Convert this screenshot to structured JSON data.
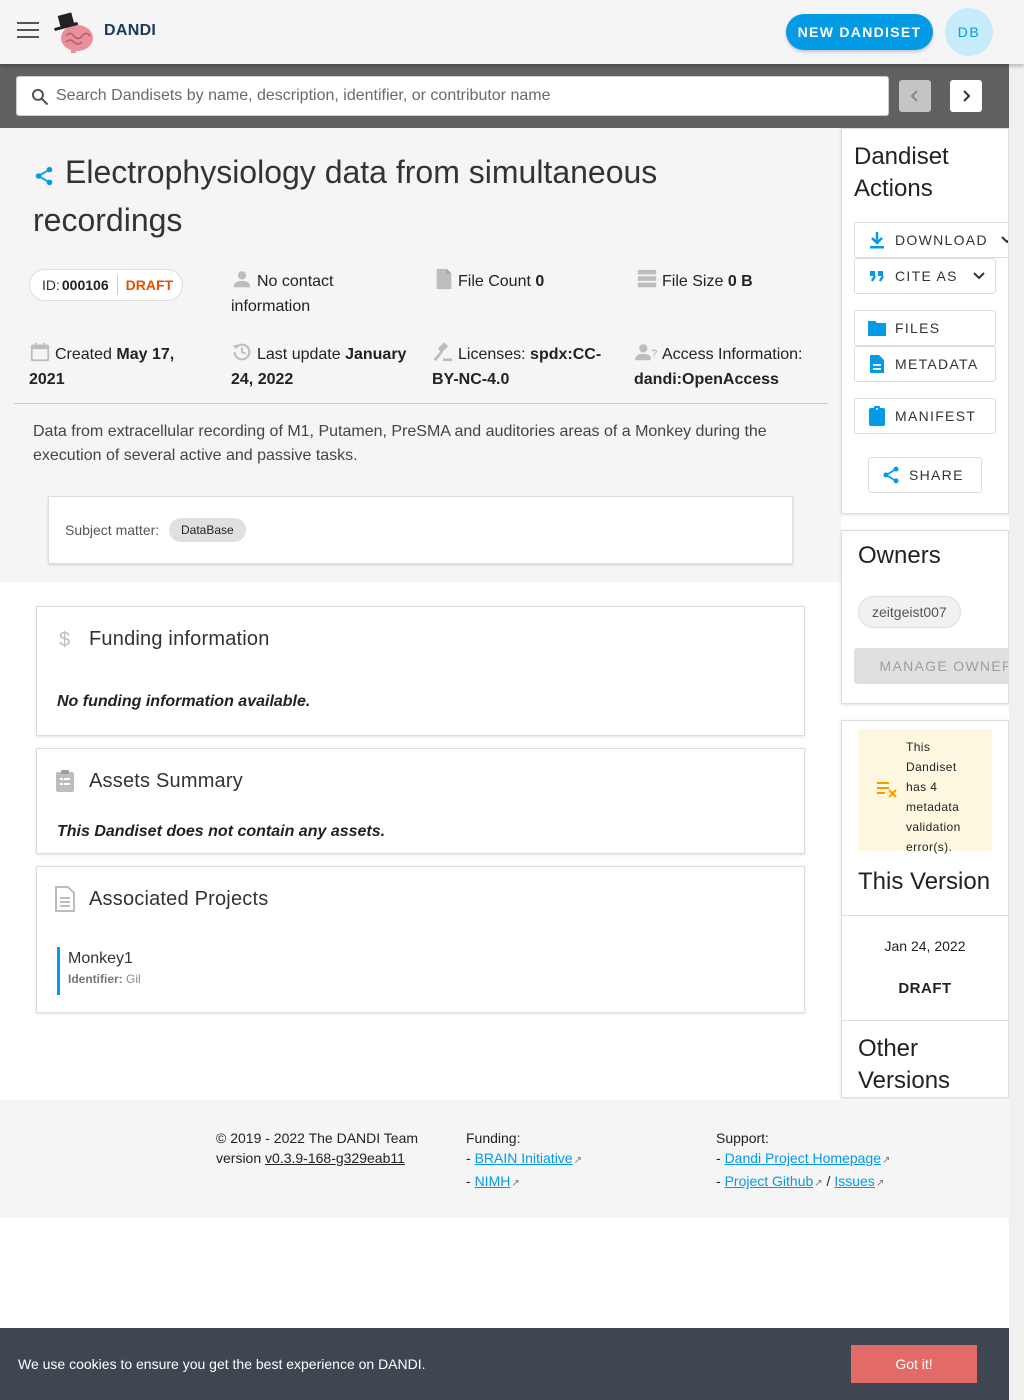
{
  "appbar": {
    "brand": "DANDI",
    "new_dandiset_label": "NEW DANDISET",
    "avatar_initials": "DB"
  },
  "search": {
    "placeholder": "Search Dandisets by name, description, identifier, or contributor name"
  },
  "dandiset": {
    "title": "Electrophysiology data from simultaneous recordings",
    "id_label": "ID:",
    "id": "000106",
    "status": "DRAFT",
    "contact": "No contact information",
    "file_count_label": "File Count",
    "file_count": "0",
    "file_size_label": "File Size",
    "file_size": "0 B",
    "created_label": "Created",
    "created": "May 17, 2021",
    "updated_label": "Last update",
    "updated": "January 24, 2022",
    "licenses_label": "Licenses:",
    "license": "spdx:CC-BY-NC-4.0",
    "access_label": "Access Information:",
    "access": "dandi:OpenAccess",
    "description": "Data from extracellular recording of M1, Putamen, PreSMA and auditories areas of a Monkey during the execution of several active and passive tasks.",
    "subject_label": "Subject matter:",
    "subject_tag": "DataBase"
  },
  "funding": {
    "title": "Funding information",
    "empty": "No funding information available."
  },
  "assets": {
    "title": "Assets Summary",
    "empty": "This Dandiset does not contain any assets."
  },
  "projects": {
    "title": "Associated Projects",
    "items": [
      {
        "name": "Monkey1",
        "identifier_label": "Identifier:",
        "identifier": "Gil"
      }
    ]
  },
  "actions": {
    "title": "Dandiset Actions",
    "download": "DOWNLOAD",
    "cite": "CITE AS",
    "files": "FILES",
    "metadata": "METADATA",
    "manifest": "MANIFEST",
    "share": "SHARE"
  },
  "owners": {
    "title": "Owners",
    "list": [
      "zeitgeist007"
    ],
    "manage": "MANAGE OWNERS"
  },
  "versions": {
    "warning": "This Dandiset has 4 metadata validation error(s).",
    "this_version_title": "This Version",
    "this_version_date": "Jan 24, 2022",
    "this_version_name": "DRAFT",
    "other_versions_title": "Other Versions"
  },
  "footer": {
    "copyright": "© 2019 - 2022 The DANDI Team",
    "version_label": "version",
    "version": "v0.3.9-168-g329eab11",
    "funding_label": "Funding:",
    "funding_links": [
      "BRAIN Initiative",
      "NIMH"
    ],
    "support_label": "Support:",
    "support_links": [
      "Dandi Project Homepage",
      "Project Github",
      "Issues"
    ]
  },
  "cookie": {
    "message": "We use cookies to ensure you get the best experience on DANDI.",
    "button": "Got it!"
  },
  "colors": {
    "primary": "#039be5",
    "draft": "#e65100",
    "cookie_bg": "#3e4651",
    "cookie_btn": "#e36b67",
    "warning_bg": "#fff8e1"
  }
}
